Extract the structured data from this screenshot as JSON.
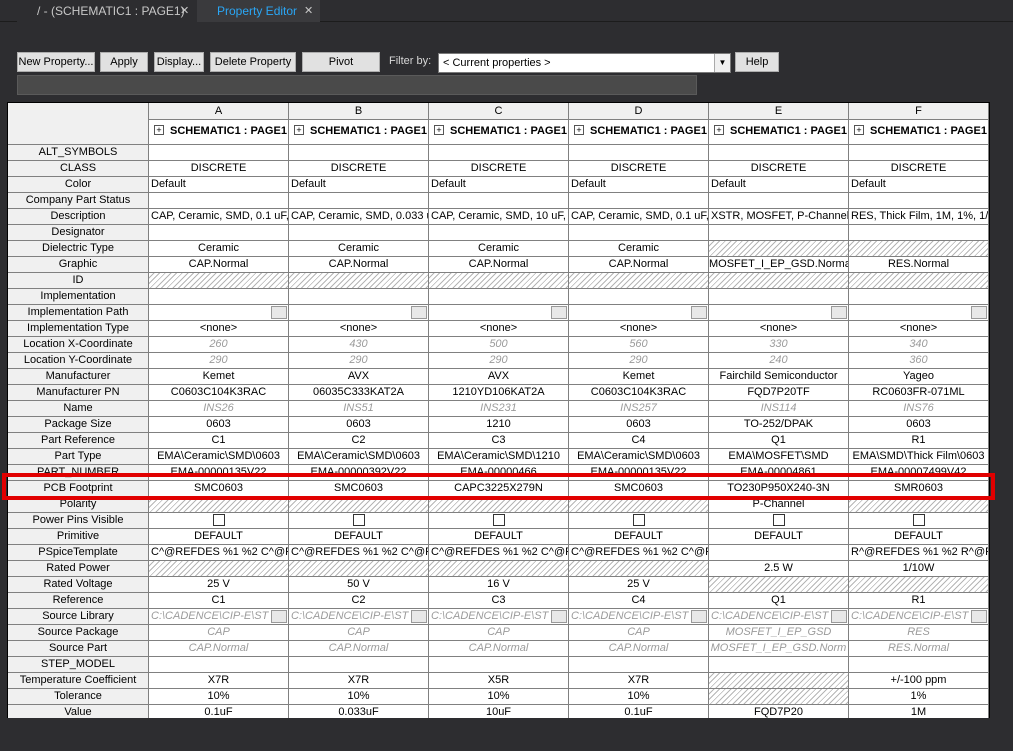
{
  "tabs": [
    {
      "label": "/ - (SCHEMATIC1 : PAGE1)",
      "close": "✕"
    },
    {
      "label": "Property Editor",
      "close": "✕"
    }
  ],
  "toolbar": {
    "new_property": "New Property...",
    "apply": "Apply",
    "display": "Display...",
    "delete_property": "Delete Property",
    "pivot": "Pivot",
    "filter_label": "Filter by:",
    "filter_value": "< Current properties >",
    "help": "Help"
  },
  "columns": [
    {
      "letter": "A",
      "schematic": "SCHEMATIC1 : PAGE1"
    },
    {
      "letter": "B",
      "schematic": "SCHEMATIC1 : PAGE1"
    },
    {
      "letter": "C",
      "schematic": "SCHEMATIC1 : PAGE1"
    },
    {
      "letter": "D",
      "schematic": "SCHEMATIC1 : PAGE1"
    },
    {
      "letter": "E",
      "schematic": "SCHEMATIC1 : PAGE1"
    },
    {
      "letter": "F",
      "schematic": "SCHEMATIC1 : PAGE1"
    }
  ],
  "rows": [
    {
      "name": "ALT_SYMBOLS",
      "cells": [
        "",
        "",
        "",
        "",
        "",
        ""
      ],
      "style": [
        "",
        "",
        "",
        "",
        "",
        ""
      ]
    },
    {
      "name": "CLASS",
      "cells": [
        "DISCRETE",
        "DISCRETE",
        "DISCRETE",
        "DISCRETE",
        "DISCRETE",
        "DISCRETE"
      ],
      "style": [
        "",
        "",
        "",
        "",
        "",
        ""
      ]
    },
    {
      "name": "Color",
      "cells": [
        "Default",
        "Default",
        "Default",
        "Default",
        "Default",
        "Default"
      ],
      "style": [
        "left",
        "left",
        "left",
        "left",
        "left",
        "left"
      ]
    },
    {
      "name": "Company Part Status",
      "cells": [
        "",
        "",
        "",
        "",
        "",
        ""
      ],
      "style": [
        "",
        "",
        "",
        "",
        "",
        ""
      ]
    },
    {
      "name": "Description",
      "cells": [
        "CAP, Ceramic, SMD, 0.1 uF,",
        "CAP, Ceramic, SMD, 0.033 u",
        "CAP, Ceramic, SMD, 10 uF,",
        "CAP, Ceramic, SMD, 0.1 uF,",
        "XSTR, MOSFET, P-Channel,",
        "RES, Thick Film, 1M, 1%, 1/1"
      ],
      "style": [
        "left",
        "left",
        "left",
        "left",
        "left",
        "left"
      ]
    },
    {
      "name": "Designator",
      "cells": [
        "",
        "",
        "",
        "",
        "",
        ""
      ],
      "style": [
        "",
        "",
        "",
        "",
        "",
        ""
      ]
    },
    {
      "name": "Dielectric Type",
      "cells": [
        "Ceramic",
        "Ceramic",
        "Ceramic",
        "Ceramic",
        "",
        ""
      ],
      "style": [
        "",
        "",
        "",
        "",
        "hatch",
        "hatch"
      ]
    },
    {
      "name": "Graphic",
      "cells": [
        "CAP.Normal",
        "CAP.Normal",
        "CAP.Normal",
        "CAP.Normal",
        "MOSFET_I_EP_GSD.Normal",
        "RES.Normal"
      ],
      "style": [
        "",
        "",
        "",
        "",
        "",
        ""
      ]
    },
    {
      "name": "ID",
      "cells": [
        "",
        "",
        "",
        "",
        "",
        ""
      ],
      "style": [
        "hatch",
        "hatch",
        "hatch",
        "hatch",
        "hatch",
        "hatch"
      ]
    },
    {
      "name": "Implementation",
      "cells": [
        "",
        "",
        "",
        "",
        "",
        ""
      ],
      "style": [
        "",
        "",
        "",
        "",
        "",
        ""
      ]
    },
    {
      "name": "Implementation Path",
      "cells": [
        "",
        "",
        "",
        "",
        "",
        ""
      ],
      "style": [
        "pick",
        "pick",
        "pick",
        "pick",
        "pick",
        "pick"
      ]
    },
    {
      "name": "Implementation Type",
      "cells": [
        "<none>",
        "<none>",
        "<none>",
        "<none>",
        "<none>",
        "<none>"
      ],
      "style": [
        "",
        "",
        "",
        "",
        "",
        ""
      ]
    },
    {
      "name": "Location X-Coordinate",
      "cells": [
        "260",
        "430",
        "500",
        "560",
        "330",
        "340"
      ],
      "style": [
        "gray",
        "gray",
        "gray",
        "gray",
        "gray",
        "gray"
      ]
    },
    {
      "name": "Location Y-Coordinate",
      "cells": [
        "290",
        "290",
        "290",
        "290",
        "240",
        "360"
      ],
      "style": [
        "gray",
        "gray",
        "gray",
        "gray",
        "gray",
        "gray"
      ]
    },
    {
      "name": "Manufacturer",
      "cells": [
        "Kemet",
        "AVX",
        "AVX",
        "Kemet",
        "Fairchild Semiconductor",
        "Yageo"
      ],
      "style": [
        "",
        "",
        "",
        "",
        "",
        ""
      ]
    },
    {
      "name": "Manufacturer PN",
      "cells": [
        "C0603C104K3RAC",
        "06035C333KAT2A",
        "1210YD106KAT2A",
        "C0603C104K3RAC",
        "FQD7P20TF",
        "RC0603FR-071ML"
      ],
      "style": [
        "",
        "",
        "",
        "",
        "",
        ""
      ]
    },
    {
      "name": "Name",
      "cells": [
        "INS26",
        "INS51",
        "INS231",
        "INS257",
        "INS114",
        "INS76"
      ],
      "style": [
        "gray",
        "gray",
        "gray",
        "gray",
        "gray",
        "gray"
      ]
    },
    {
      "name": "Package Size",
      "cells": [
        "0603",
        "0603",
        "1210",
        "0603",
        "TO-252/DPAK",
        "0603"
      ],
      "style": [
        "",
        "",
        "",
        "",
        "",
        ""
      ]
    },
    {
      "name": "Part Reference",
      "cells": [
        "C1",
        "C2",
        "C3",
        "C4",
        "Q1",
        "R1"
      ],
      "style": [
        "",
        "",
        "",
        "",
        "",
        ""
      ]
    },
    {
      "name": "Part Type",
      "cells": [
        "EMA\\Ceramic\\SMD\\0603",
        "EMA\\Ceramic\\SMD\\0603",
        "EMA\\Ceramic\\SMD\\1210",
        "EMA\\Ceramic\\SMD\\0603",
        "EMA\\MOSFET\\SMD",
        "EMA\\SMD\\Thick Film\\0603"
      ],
      "style": [
        "",
        "",
        "",
        "",
        "",
        ""
      ]
    },
    {
      "name": "PART_NUMBER",
      "cells": [
        "EMA-00000135V22",
        "EMA-00000392V22",
        "EMA-00000466",
        "EMA-00000135V22",
        "EMA-00004861",
        "EMA-00007499V42"
      ],
      "style": [
        "",
        "",
        "",
        "",
        "",
        ""
      ]
    },
    {
      "name": "PCB Footprint",
      "cells": [
        "SMC0603",
        "SMC0603",
        "CAPC3225X279N",
        "SMC0603",
        "TO230P950X240-3N",
        "SMR0603"
      ],
      "style": [
        "",
        "",
        "",
        "",
        "",
        ""
      ]
    },
    {
      "name": "Polarity",
      "cells": [
        "",
        "",
        "",
        "",
        "P-Channel",
        ""
      ],
      "style": [
        "hatch",
        "hatch",
        "hatch",
        "hatch",
        "",
        "hatch"
      ]
    },
    {
      "name": "Power Pins Visible",
      "cells": [
        "",
        "",
        "",
        "",
        "",
        ""
      ],
      "style": [
        "chk",
        "chk",
        "chk",
        "chk",
        "chk",
        "chk"
      ]
    },
    {
      "name": "Primitive",
      "cells": [
        "DEFAULT",
        "DEFAULT",
        "DEFAULT",
        "DEFAULT",
        "DEFAULT",
        "DEFAULT"
      ],
      "style": [
        "",
        "",
        "",
        "",
        "",
        ""
      ]
    },
    {
      "name": "PSpiceTemplate",
      "cells": [
        "C^@REFDES %1 %2 C^@R",
        "C^@REFDES %1 %2 C^@R",
        "C^@REFDES %1 %2 C^@R",
        "C^@REFDES %1 %2 C^@R",
        "",
        "R^@REFDES %1 %2 R^@R"
      ],
      "style": [
        "left",
        "left",
        "left",
        "left",
        "",
        "left"
      ]
    },
    {
      "name": "Rated Power",
      "cells": [
        "",
        "",
        "",
        "",
        "2.5 W",
        "1/10W"
      ],
      "style": [
        "hatch",
        "hatch",
        "hatch",
        "hatch",
        "",
        ""
      ]
    },
    {
      "name": "Rated Voltage",
      "cells": [
        "25 V",
        "50 V",
        "16 V",
        "25 V",
        "",
        ""
      ],
      "style": [
        "",
        "",
        "",
        "",
        "hatch",
        "hatch"
      ]
    },
    {
      "name": "Reference",
      "cells": [
        "C1",
        "C2",
        "C3",
        "C4",
        "Q1",
        "R1"
      ],
      "style": [
        "",
        "",
        "",
        "",
        "",
        ""
      ]
    },
    {
      "name": "Source Library",
      "cells": [
        "C:\\CADENCE\\CIP-E\\ST",
        "C:\\CADENCE\\CIP-E\\ST",
        "C:\\CADENCE\\CIP-E\\ST",
        "C:\\CADENCE\\CIP-E\\ST",
        "C:\\CADENCE\\CIP-E\\ST",
        "C:\\CADENCE\\CIP-E\\ST"
      ],
      "style": [
        "graypick",
        "graypick",
        "graypick",
        "graypick",
        "graypick",
        "graypick"
      ]
    },
    {
      "name": "Source Package",
      "cells": [
        "CAP",
        "CAP",
        "CAP",
        "CAP",
        "MOSFET_I_EP_GSD",
        "RES"
      ],
      "style": [
        "gray",
        "gray",
        "gray",
        "gray",
        "gray",
        "gray"
      ]
    },
    {
      "name": "Source Part",
      "cells": [
        "CAP.Normal",
        "CAP.Normal",
        "CAP.Normal",
        "CAP.Normal",
        "MOSFET_I_EP_GSD.Norm",
        "RES.Normal"
      ],
      "style": [
        "gray",
        "gray",
        "gray",
        "gray",
        "gray",
        "gray"
      ]
    },
    {
      "name": "STEP_MODEL",
      "cells": [
        "",
        "",
        "",
        "",
        "",
        ""
      ],
      "style": [
        "",
        "",
        "",
        "",
        "",
        ""
      ]
    },
    {
      "name": "Temperature Coefficient",
      "cells": [
        "X7R",
        "X7R",
        "X5R",
        "X7R",
        "",
        "+/-100 ppm"
      ],
      "style": [
        "",
        "",
        "",
        "",
        "hatch",
        ""
      ]
    },
    {
      "name": "Tolerance",
      "cells": [
        "10%",
        "10%",
        "10%",
        "10%",
        "",
        "1%"
      ],
      "style": [
        "",
        "",
        "",
        "",
        "hatch",
        ""
      ]
    },
    {
      "name": "Value",
      "cells": [
        "0.1uF",
        "0.033uF",
        "10uF",
        "0.1uF",
        "FQD7P20",
        "1M"
      ],
      "style": [
        "",
        "",
        "",
        "",
        "",
        ""
      ]
    }
  ]
}
